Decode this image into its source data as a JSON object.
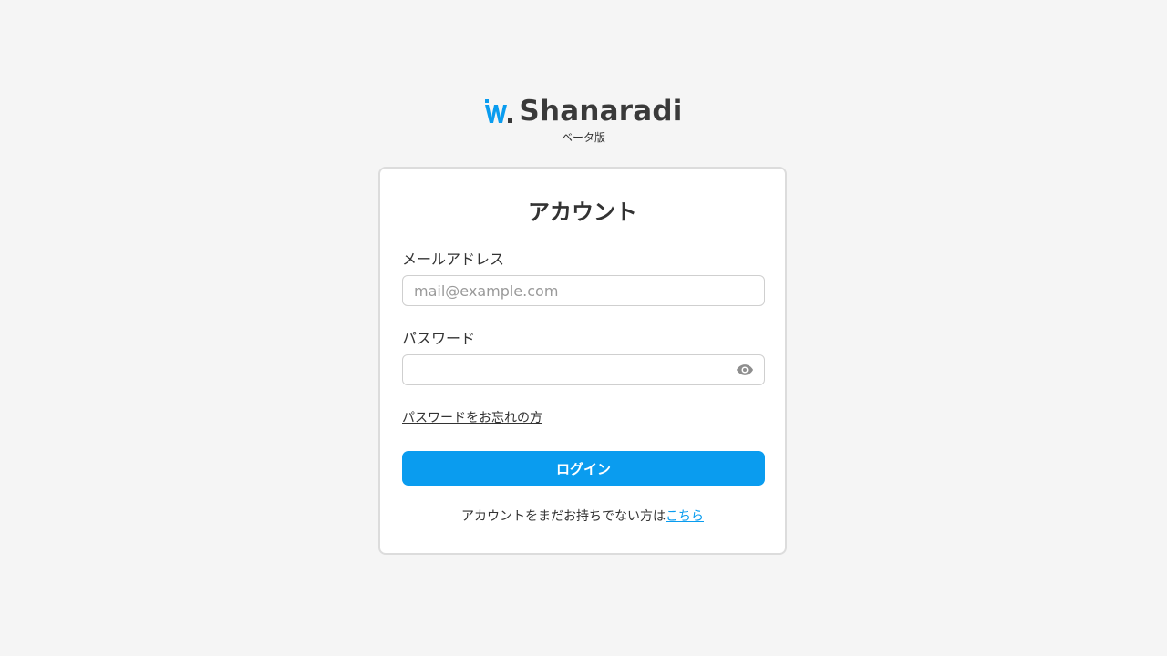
{
  "brand": {
    "name": "Shanaradi",
    "badge": "ベータ版",
    "logo_icon": "shanaradi-logo-icon",
    "accent_color": "#0a9cef"
  },
  "card": {
    "title": "アカウント",
    "email": {
      "label": "メールアドレス",
      "value": "",
      "placeholder": "mail@example.com"
    },
    "password": {
      "label": "パスワード",
      "value": "",
      "placeholder": "",
      "toggle_icon": "eye-icon"
    },
    "forgot_link": "パスワードをお忘れの方",
    "login_button": "ログイン",
    "signup_prompt": "アカウントをまだお持ちでない方は",
    "signup_link": "こちら"
  }
}
